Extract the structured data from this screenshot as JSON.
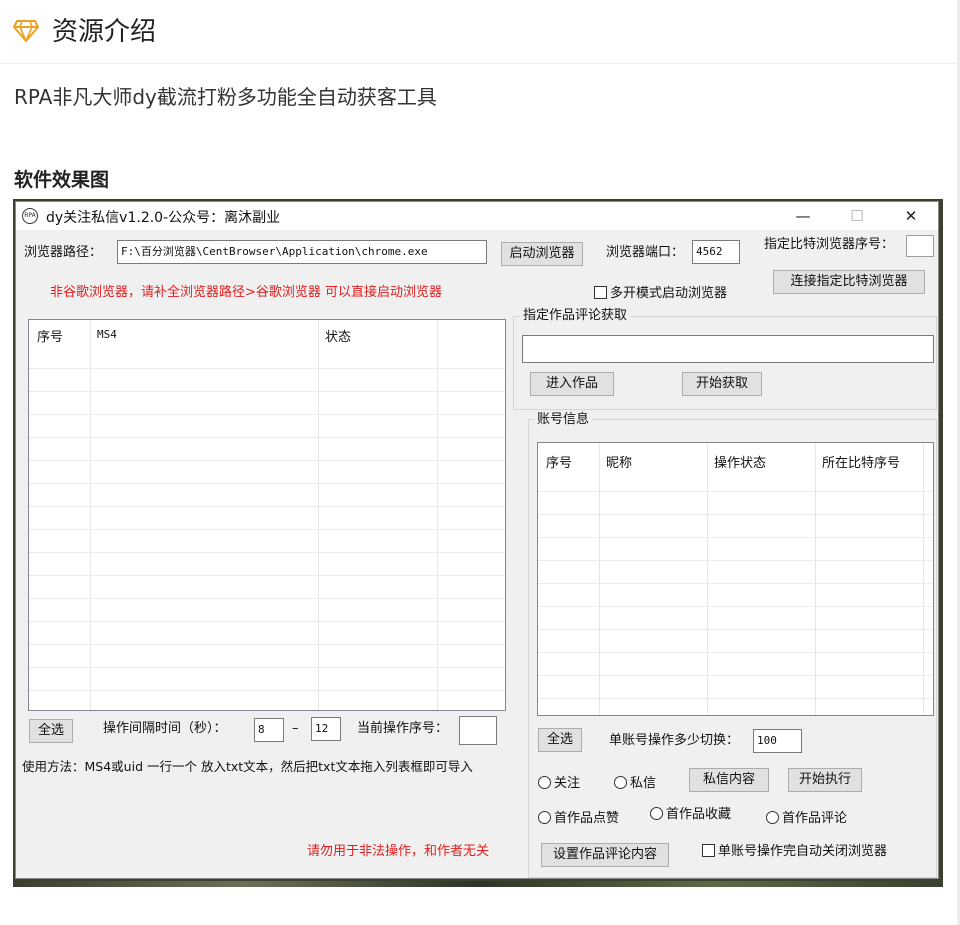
{
  "article": {
    "section_title": "资源介绍",
    "intro": "RPA非凡大师dy截流打粉多功能全自动获客工具",
    "effect_heading": "软件效果图"
  },
  "colors": {
    "diamond": "#f0a020",
    "warning_red": "#e02020"
  },
  "icons": {
    "section": "diamond-icon",
    "app": "app-logo-icon"
  },
  "window": {
    "title": "dy关注私信v1.2.0-公众号：离沐副业",
    "app_icon_text": "RPA",
    "minimize": "—",
    "maximize": "☐",
    "close": "✕"
  },
  "browser": {
    "path_label": "浏览器路径：",
    "path_value": "F:\\百分浏览器\\CentBrowser\\Application\\chrome.exe",
    "launch_button": "启动浏览器",
    "port_label": "浏览器端口：",
    "port_value": "4562",
    "bit_index_label": "指定比特浏览器序号：",
    "bit_index_value": "",
    "notice": "非谷歌浏览器，请补全浏览器路径>谷歌浏览器 可以直接启动浏览器",
    "multi_open_checkbox": "多开模式启动浏览器",
    "connect_bit_button": "连接指定比特浏览器"
  },
  "left_table": {
    "columns": [
      "序号",
      "MS4",
      "状态"
    ]
  },
  "comment_group": {
    "title": "指定作品评论获取",
    "url_value": "",
    "enter_button": "进入作品",
    "start_button": "开始获取"
  },
  "account_group": {
    "title": "账号信息",
    "columns": [
      "序号",
      "昵称",
      "操作状态",
      "所在比特序号"
    ],
    "select_all": "全选",
    "switch_label": "单账号操作多少切换：",
    "switch_value": "100",
    "radio_follow": "关注",
    "radio_dm": "私信",
    "dm_content_button": "私信内容",
    "start_exec_button": "开始执行",
    "radio_like": "首作品点赞",
    "radio_collect": "首作品收藏",
    "radio_comment": "首作品评论",
    "set_comment_button": "设置作品评论内容",
    "auto_close_checkbox": "单账号操作完自动关闭浏览器"
  },
  "bottom_left": {
    "select_all": "全选",
    "interval_label": "操作间隔时间（秒）：",
    "interval_min": "8",
    "dash": "–",
    "interval_max": "12",
    "current_index_label": "当前操作序号：",
    "current_index_value": "",
    "usage": "使用方法：MS4或uid 一行一个 放入txt文本，然后把txt文本拖入列表框即可导入",
    "disclaimer": "请勿用于非法操作，和作者无关"
  }
}
